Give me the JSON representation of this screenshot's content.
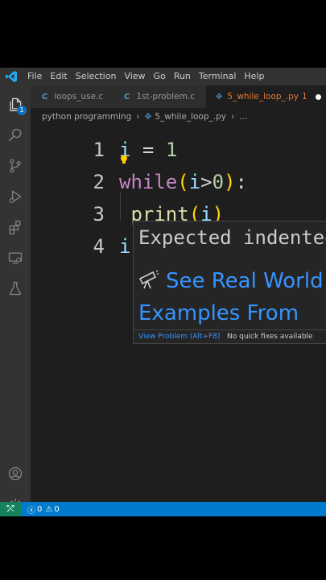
{
  "menubar": {
    "items": [
      "File",
      "Edit",
      "Selection",
      "View",
      "Go",
      "Run",
      "Terminal",
      "Help"
    ]
  },
  "tabs": [
    {
      "label": "loops_use.c",
      "icon": "c-file-icon",
      "icon_text": "C"
    },
    {
      "label": "1st-problem.c",
      "icon": "c-file-icon",
      "icon_text": "C"
    },
    {
      "label": "5_while_loop_.py",
      "icon": "python-file-icon",
      "problem_count": "1",
      "modified": true
    }
  ],
  "breadcrumb": {
    "folder": "python programming",
    "file": "5_while_loop_.py",
    "ellipsis": "..."
  },
  "editor": {
    "lines": [
      {
        "number": "1",
        "tokens": [
          [
            "var",
            "i"
          ],
          [
            "op",
            " = "
          ],
          [
            "num",
            "1"
          ]
        ]
      },
      {
        "number": "2",
        "tokens": [
          [
            "kw",
            "while"
          ],
          [
            "paren",
            "("
          ],
          [
            "var",
            "i"
          ],
          [
            "op",
            ">"
          ],
          [
            "num",
            "0"
          ],
          [
            "paren",
            ")"
          ],
          [
            "op",
            ":"
          ]
        ]
      },
      {
        "number": "3",
        "tokens": [
          [
            "op",
            " "
          ],
          [
            "fn",
            "print"
          ],
          [
            "paren",
            "("
          ],
          [
            "var",
            "i"
          ],
          [
            "paren",
            ")"
          ]
        ]
      },
      {
        "number": "4",
        "tokens": [
          [
            "var",
            "i"
          ]
        ]
      }
    ]
  },
  "hover": {
    "message": "Expected indented block",
    "link_text": "See Real World Examples From GitHub",
    "view_problem": "View Problem (Alt+F8)",
    "no_quick_fixes": "No quick fixes available"
  },
  "statusbar": {
    "remote_icon": "remote-icon",
    "errors": "0",
    "warnings": "0"
  },
  "colors": {
    "accent": "#007acc",
    "remote": "#16825d",
    "error": "#f14c4c",
    "modified_tab": "#e37933"
  }
}
